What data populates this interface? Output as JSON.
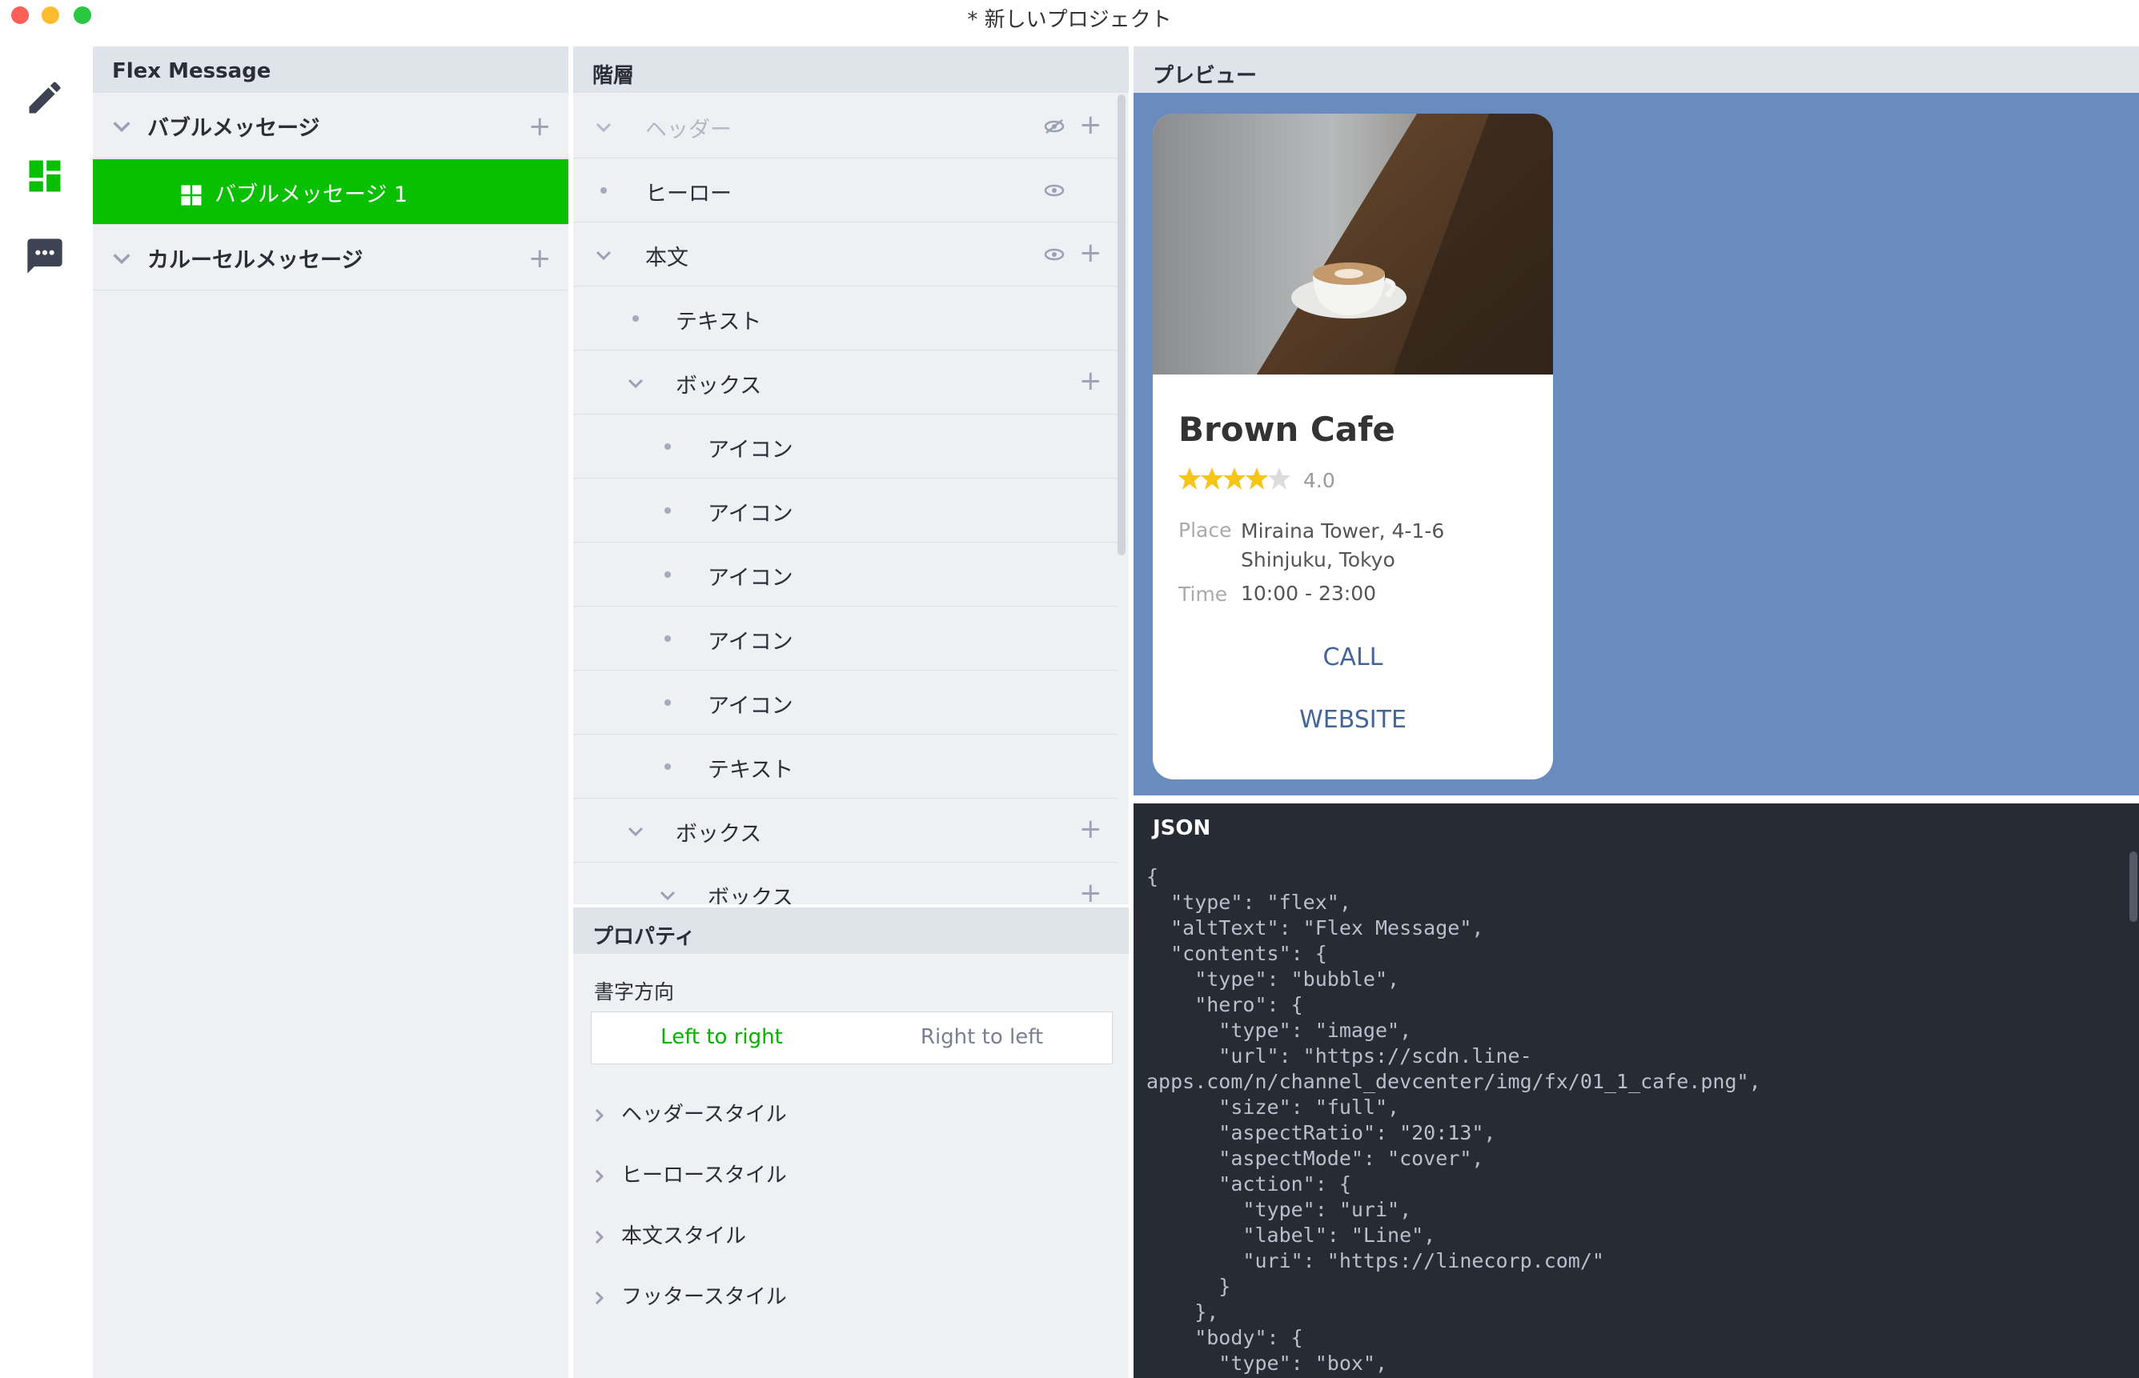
{
  "window": {
    "title": "* 新しいプロジェクト"
  },
  "colors": {
    "accent": "#08c000",
    "preview_bg": "#6a8bbd",
    "json_bg": "#272b33",
    "link": "#42659a"
  },
  "rail": [
    "pencil-icon",
    "dashboard-icon",
    "chat-icon"
  ],
  "left_panel": {
    "title": "Flex Message",
    "items": [
      {
        "label": "バブルメッセージ",
        "expanded": true
      },
      {
        "label": "バブルメッセージ 1",
        "selected": true
      },
      {
        "label": "カルーセルメッセージ",
        "expanded": true
      }
    ]
  },
  "hierarchy": {
    "title": "階層",
    "items": [
      {
        "label": "ヘッダー",
        "hidden": true
      },
      {
        "label": "ヒーロー"
      },
      {
        "label": "本文"
      },
      {
        "label": "テキスト"
      },
      {
        "label": "ボックス"
      },
      {
        "label": "アイコン"
      },
      {
        "label": "アイコン"
      },
      {
        "label": "アイコン"
      },
      {
        "label": "アイコン"
      },
      {
        "label": "アイコン"
      },
      {
        "label": "テキスト"
      },
      {
        "label": "ボックス"
      },
      {
        "label": "ボックス"
      }
    ]
  },
  "properties": {
    "title": "プロパティ",
    "direction_label": "書字方向",
    "direction_options": [
      "Left to right",
      "Right to left"
    ],
    "selected_direction": "Left to right",
    "sections": [
      "ヘッダースタイル",
      "ヒーロースタイル",
      "本文スタイル",
      "フッタースタイル"
    ]
  },
  "preview": {
    "title": "プレビュー",
    "card": {
      "name": "Brown Cafe",
      "rating_stars": 4,
      "rating": "4.0",
      "place_label": "Place",
      "place_value": "Miraina Tower, 4-1-6 Shinjuku, Tokyo",
      "time_label": "Time",
      "time_value": "10:00 - 23:00",
      "buttons": [
        "CALL",
        "WEBSITE"
      ]
    }
  },
  "json_panel": {
    "title": "JSON",
    "lines": [
      "{",
      "  \"type\": \"flex\",",
      "  \"altText\": \"Flex Message\",",
      "  \"contents\": {",
      "    \"type\": \"bubble\",",
      "    \"hero\": {",
      "      \"type\": \"image\",",
      "      \"url\": \"https://scdn.line-",
      "apps.com/n/channel_devcenter/img/fx/01_1_cafe.png\",",
      "      \"size\": \"full\",",
      "      \"aspectRatio\": \"20:13\",",
      "      \"aspectMode\": \"cover\",",
      "      \"action\": {",
      "        \"type\": \"uri\",",
      "        \"label\": \"Line\",",
      "        \"uri\": \"https://linecorp.com/\"",
      "      }",
      "    },",
      "    \"body\": {",
      "      \"type\": \"box\","
    ]
  }
}
